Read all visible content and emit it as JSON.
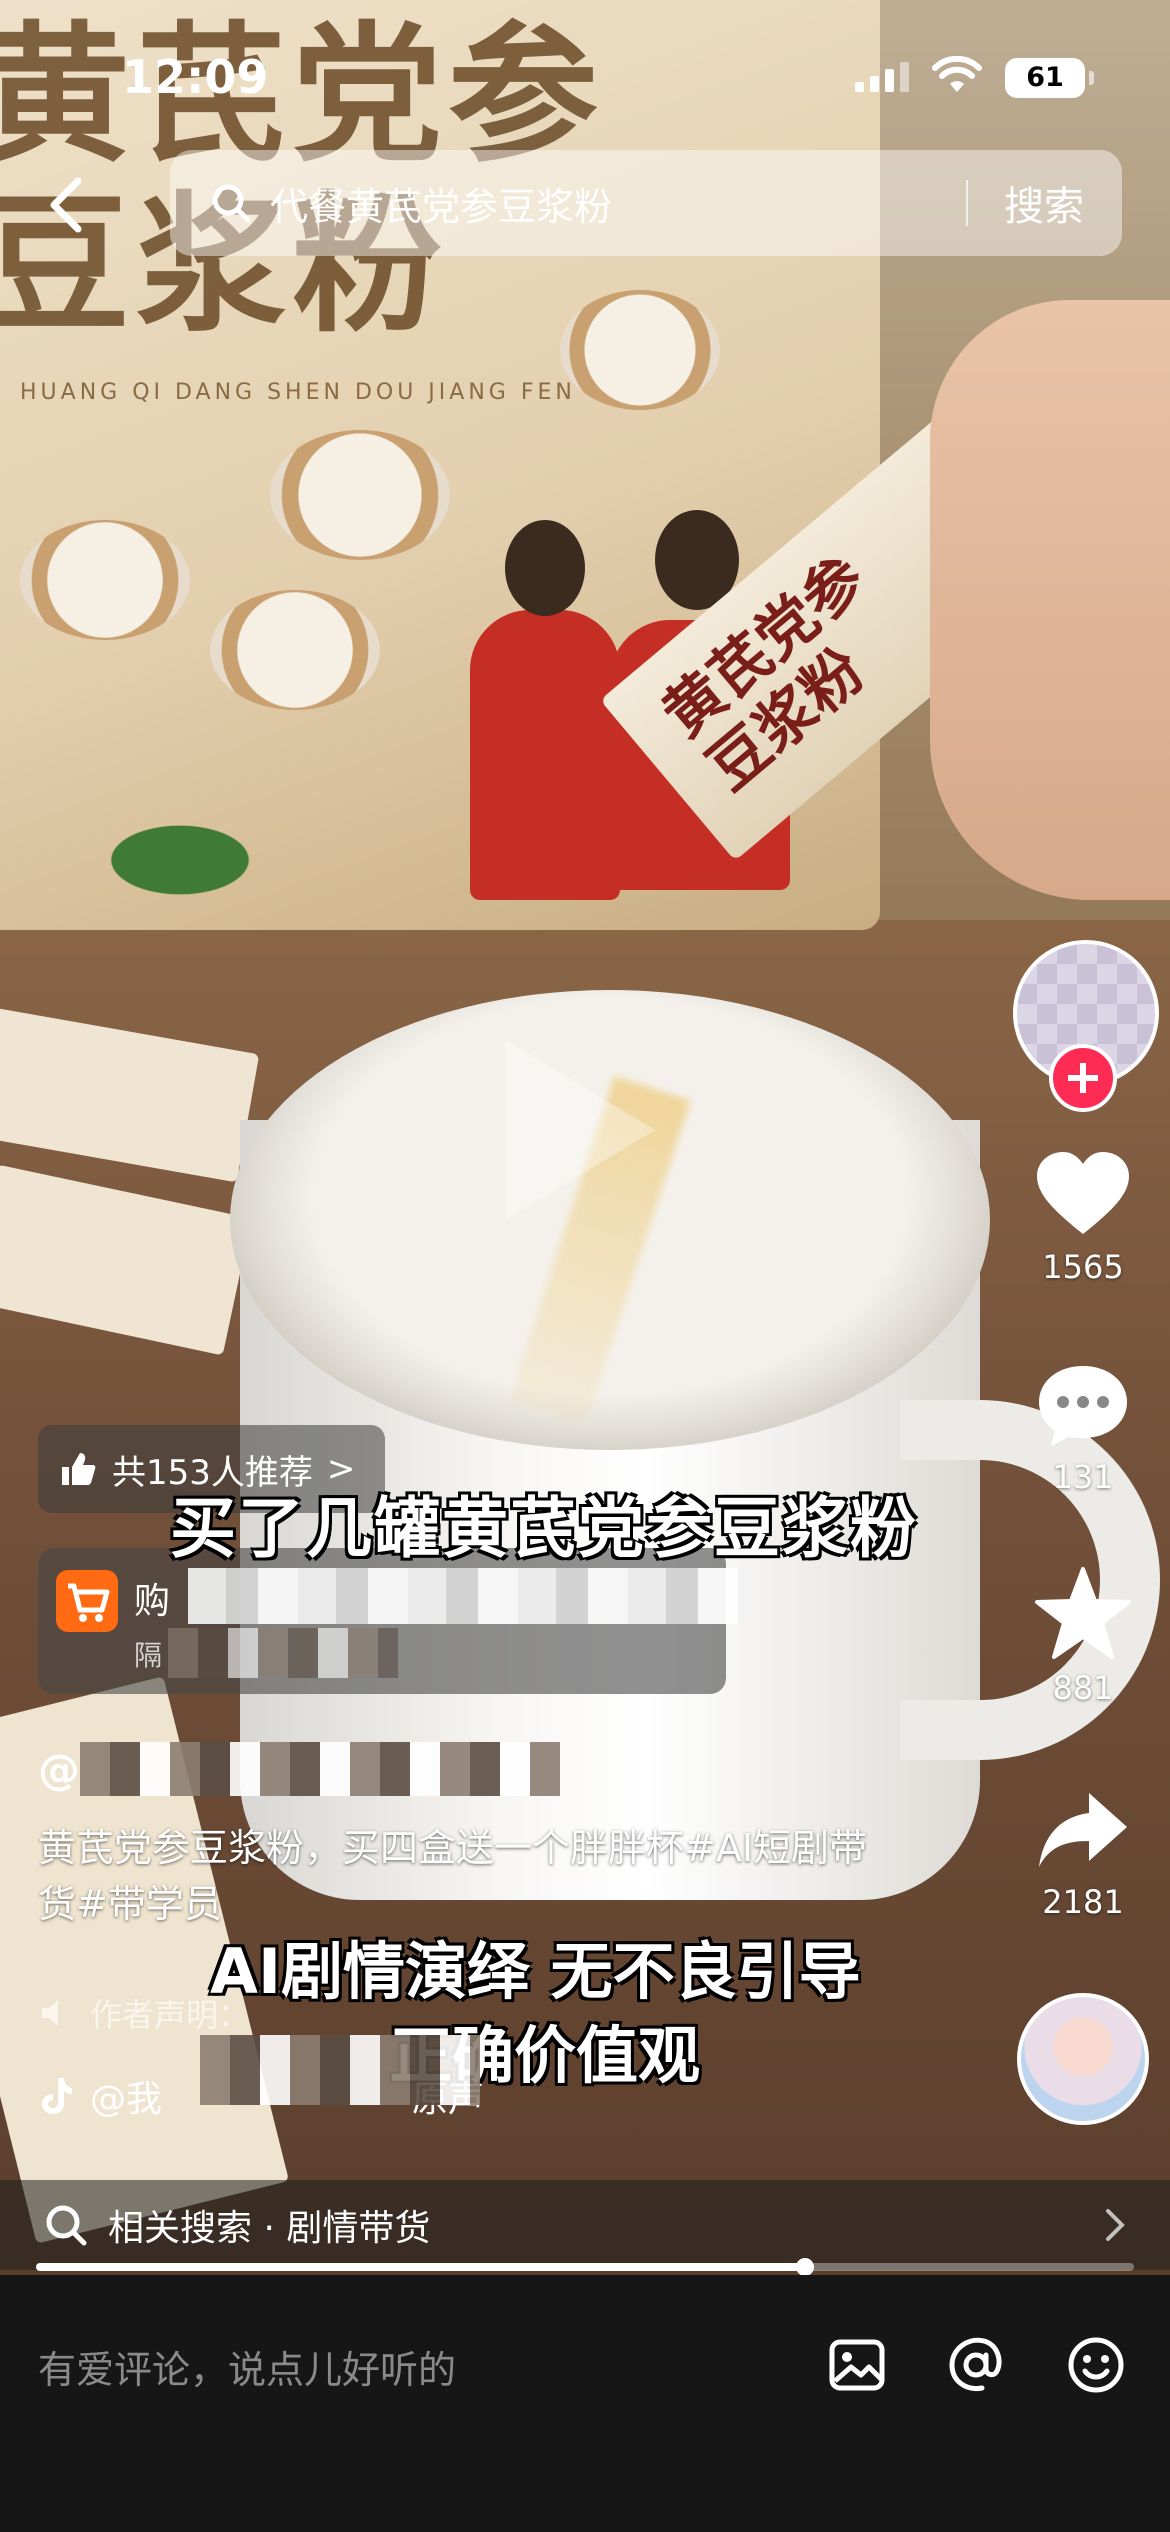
{
  "status_bar": {
    "time": "12:09",
    "battery": "61"
  },
  "search": {
    "query": "代餐黄芪党参豆浆粉",
    "button_label": "搜索"
  },
  "video": {
    "box_title_line1": "黄芪党参",
    "box_title_line2": "豆浆粉",
    "box_pinyin": "HUANG QI DANG SHEN DOU JIANG FEN",
    "sachet_line1": "黄芪党参",
    "sachet_line2": "豆浆粉",
    "caption_top": "买了几罐黄芪党参豆浆粉",
    "caption_bottom_line1": "AI剧情演绎  无不良引导",
    "caption_bottom_line2": "正确价值观",
    "progress": 0.7
  },
  "actions": {
    "likes": "1565",
    "comments": "131",
    "favorites": "881",
    "shares": "2181"
  },
  "recommend": {
    "label": "共153人推荐",
    "arrow": ">"
  },
  "shop": {
    "title_prefix": "购",
    "subtitle_prefix": "隔"
  },
  "author": {
    "name_prefix": "@"
  },
  "description": "黄芪党参豆浆粉，买四盒送一个胖胖杯#AI短剧带货#带学员",
  "declaration": "作者声明：",
  "music": {
    "prefix": "@我",
    "suffix": "原声"
  },
  "related": {
    "label": "相关搜索 · 剧情带货"
  },
  "comment": {
    "placeholder": "有爱评论，说点儿好听的"
  }
}
